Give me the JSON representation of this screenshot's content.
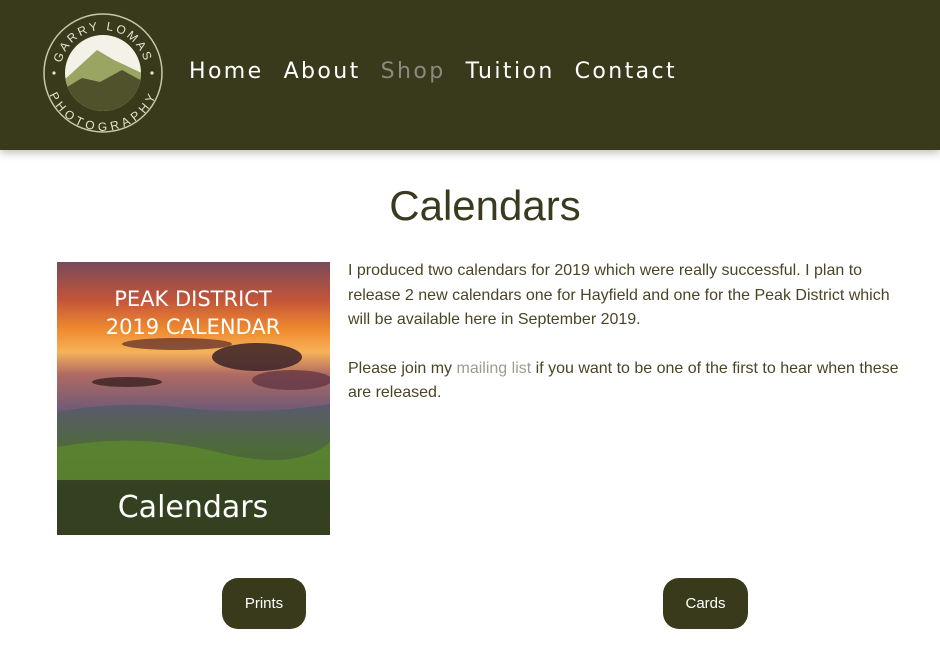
{
  "header": {
    "logo": {
      "name_top": "GARRY LOMAS",
      "name_bottom": "PHOTOGRAPHY",
      "icon": "mountain-logo"
    },
    "nav": [
      {
        "label": "Home",
        "active": false
      },
      {
        "label": "About",
        "active": false
      },
      {
        "label": "Shop",
        "active": true
      },
      {
        "label": "Tuition",
        "active": false
      },
      {
        "label": "Contact",
        "active": false
      }
    ]
  },
  "main": {
    "title": "Calendars",
    "cover_image": {
      "line1": "PEAK DISTRICT",
      "line2": "2019 CALENDAR",
      "caption": "Calendars"
    },
    "paragraph1": "I produced two calendars for 2019 which were really successful. I plan to release 2 new calendars one for Hayfield and one for the Peak District which will be available here in September 2019.",
    "paragraph2_before": "Please join my ",
    "paragraph2_link": "mailing list",
    "paragraph2_after": " if you want to be one of the first to hear when these are released."
  },
  "buttons": {
    "prints": "Prints",
    "cards": "Cards"
  },
  "colors": {
    "header_bg": "#383a1b",
    "nav_active": "#8a8a80",
    "link": "#9c9c90"
  }
}
